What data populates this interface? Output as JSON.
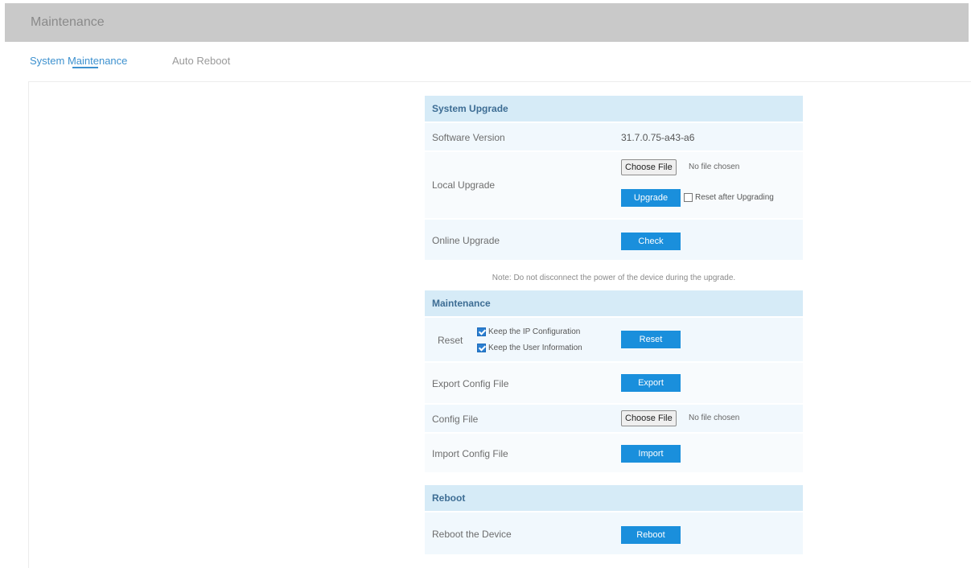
{
  "window": {
    "title": "Maintenance"
  },
  "tabs": [
    {
      "label": "System Maintenance",
      "active": true
    },
    {
      "label": "Auto Reboot",
      "active": false
    }
  ],
  "system_upgrade": {
    "header": "System Upgrade",
    "software_version_label": "Software Version",
    "software_version_value": "31.7.0.75-a43-a6",
    "local_upgrade_label": "Local Upgrade",
    "choose_file_label": "Choose File",
    "no_file_label": "No file chosen",
    "upgrade_button": "Upgrade",
    "reset_after_upgrading_label": "Reset after Upgrading",
    "reset_after_upgrading_checked": false,
    "online_upgrade_label": "Online Upgrade",
    "check_button": "Check"
  },
  "note": "Note: Do not disconnect the power of the device during the upgrade.",
  "maintenance": {
    "header": "Maintenance",
    "reset_label": "Reset",
    "keep_ip_label": "Keep the IP Configuration",
    "keep_ip_checked": true,
    "keep_user_label": "Keep the User Information",
    "keep_user_checked": true,
    "reset_button": "Reset",
    "export_label": "Export Config File",
    "export_button": "Export",
    "config_file_label": "Config File",
    "choose_file_label": "Choose File",
    "no_file_label": "No file chosen",
    "import_label": "Import Config File",
    "import_button": "Import"
  },
  "reboot": {
    "header": "Reboot",
    "reboot_device_label": "Reboot the Device",
    "reboot_button": "Reboot"
  },
  "colors": {
    "accent": "#1a8fdc",
    "header_bg": "#c9c9c9",
    "section_bg": "#d6ebf7",
    "row_bg": "#f1f8fd"
  }
}
